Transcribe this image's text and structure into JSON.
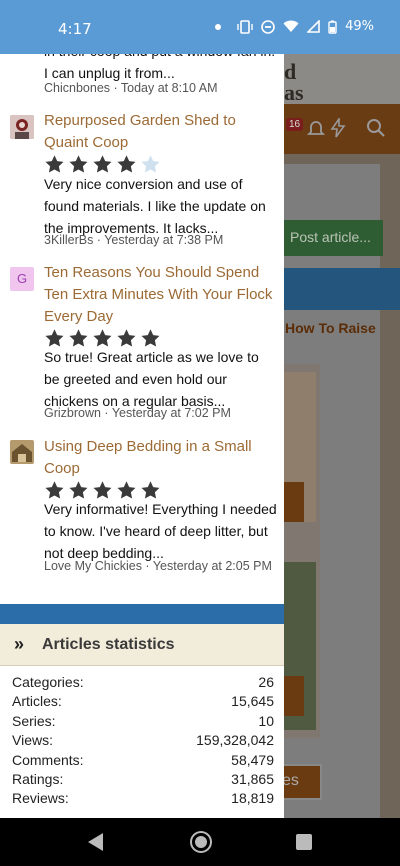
{
  "status": {
    "time": "4:17",
    "battery": "49%"
  },
  "background_page": {
    "logo": "d\nas",
    "notification_count": "16",
    "post_button": "Post article...",
    "heading_fragment": "How To Raise",
    "button_fragment": "es"
  },
  "panel": {
    "comments": [
      {
        "title": "",
        "text": "in their coop and put a window fan in. I can unplug it from...",
        "meta": "Chicnbones · Today at 8:10 AM",
        "rating": null,
        "icon": "none"
      },
      {
        "title": "Repurposed Garden Shed to Quaint Coop",
        "text": "Very nice conversion and use of found materials. I like the update on the improvements. It lacks...",
        "meta": "3KillerBs · Yesterday at 7:38 PM",
        "rating": 4,
        "icon": "avatar-image-icon"
      },
      {
        "title": "Ten Reasons You Should Spend Ten Extra Minutes With Your Flock Every Day",
        "text": "So true! Great article as we love to be greeted and even hold our chickens on a regular basis...",
        "meta": "Grizbrown · Yesterday at 7:02 PM",
        "rating": 5,
        "icon": "letter-avatar-icon",
        "icon_letter": "G"
      },
      {
        "title": "Using Deep Bedding in a Small Coop",
        "text": "Very informative! Everything I needed to know. I've heard of deep litter, but not deep bedding...",
        "meta": "Love My Chickies · Yesterday at 2:05 PM",
        "rating": 5,
        "icon": "coop-thumbnail-icon"
      }
    ],
    "stats_title": "Articles statistics",
    "stats": [
      {
        "label": "Categories:",
        "value": "26"
      },
      {
        "label": "Articles:",
        "value": "15,645"
      },
      {
        "label": "Series:",
        "value": "10"
      },
      {
        "label": "Views:",
        "value": "159,328,042"
      },
      {
        "label": "Comments:",
        "value": "58,479"
      },
      {
        "label": "Ratings:",
        "value": "31,865"
      },
      {
        "label": "Reviews:",
        "value": "18,819"
      }
    ]
  },
  "colors": {
    "link": "#9c6a35",
    "star_filled": "#3a3a3a",
    "star_empty": "#cfe0ef",
    "accent_blue": "#2a6da8",
    "status_bar": "#5b9bd5"
  }
}
